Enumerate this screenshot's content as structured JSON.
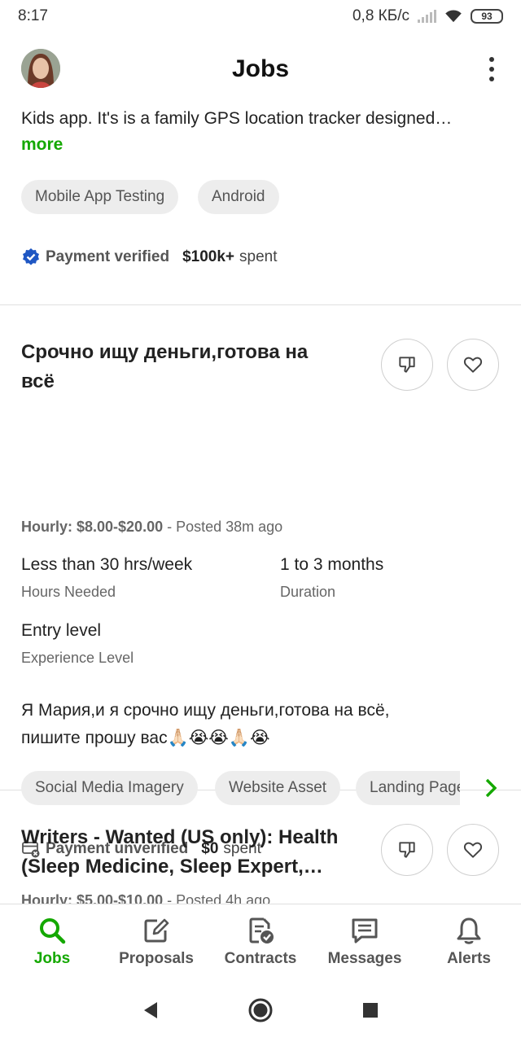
{
  "status_bar": {
    "time": "8:17",
    "net_speed": "0,8 КБ/с",
    "battery": "93"
  },
  "header": {
    "title": "Jobs"
  },
  "card1": {
    "description": "Kids app. It's is a family GPS location tracker designed…",
    "more": "more",
    "skills": [
      "Mobile App Testing",
      "Android"
    ],
    "payment_status": "Payment verified",
    "spent_amount": "$100k+",
    "spent_label": "spent"
  },
  "card2": {
    "title_line1": "Срочно ищу деньги,готова на",
    "title_line2": "всё",
    "rate_label": "Hourly: $8.00-$20.00",
    "posted": " - Posted 38m ago",
    "hours_value": "Less than 30 hrs/week",
    "hours_label": "Hours Needed",
    "duration_value": "1 to 3 months",
    "duration_label": "Duration",
    "level_value": "Entry level",
    "level_label": "Experience Level",
    "desc_line1": "Я Мария,и я срочно ищу деньги,готова на всё,",
    "desc_line2": "пишите прошу вас🙏🏻😭😭🙏🏻😭",
    "skills": [
      "Social Media Imagery",
      "Website Asset",
      "Landing Page"
    ],
    "payment_status": "Payment unverified",
    "spent_amount": "$0",
    "spent_label": "spent"
  },
  "card3": {
    "title_line1": "Writers - Wanted (US only): Health",
    "title_line2": "(Sleep Medicine, Sleep Expert,…",
    "rate_label": "Hourly: $5.00-$10.00",
    "posted": " - Posted 4h ago"
  },
  "bottom_nav": {
    "items": [
      {
        "label": "Jobs",
        "icon": "search-icon"
      },
      {
        "label": "Proposals",
        "icon": "edit-icon"
      },
      {
        "label": "Contracts",
        "icon": "contract-icon"
      },
      {
        "label": "Messages",
        "icon": "message-icon"
      },
      {
        "label": "Alerts",
        "icon": "bell-icon"
      }
    ]
  },
  "colors": {
    "accent": "#14a800",
    "verified_blue": "#1f57c3"
  }
}
